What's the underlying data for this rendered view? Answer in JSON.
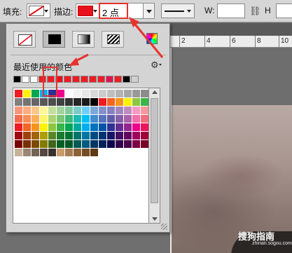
{
  "options_bar": {
    "fill_label": "填充:",
    "stroke_label": "描边:",
    "stroke_size_value": "2 点",
    "width_label": "W:",
    "height_label": "H",
    "stroke_color": "#e8101c"
  },
  "panel": {
    "type_buttons": [
      "none-icon",
      "solid-color-icon",
      "gradient-icon",
      "pattern-icon"
    ],
    "recent_label": "最近使用的颜色",
    "recent_colors": [
      "#000000",
      "#ffffff",
      "#ffffff",
      "#ed1c24",
      "#ed1c24",
      "#e8101c",
      "#ed1c24",
      "#ed1c24",
      "#ed1c24",
      "#ed1c24",
      "#ed1c24",
      "#e0144c",
      "#ed1c24",
      "#000000",
      "#d0d0d0"
    ],
    "swatch_rows": [
      [
        "#ed1c24",
        "#fff200",
        "#00a651",
        "#00aeef",
        "#2e3192",
        "#ec008c",
        "#ffffff",
        "#f2f2f2",
        "#e6e6e6",
        "#d9d9d9",
        "#cccccc",
        "#bfbfbf",
        "#b3b3b3",
        "#a6a6a6",
        "#999999",
        "#8c8c8c"
      ],
      [
        "#808080",
        "#737373",
        "#666666",
        "#595959",
        "#4d4d4d",
        "#404040",
        "#333333",
        "#262626",
        "#1a1a1a",
        "#000000",
        "#ed1c24",
        "#f26522",
        "#f7941d",
        "#fff200",
        "#8dc63f",
        "#39b54a"
      ],
      [
        "#f69679",
        "#f9ad81",
        "#fdc689",
        "#fff799",
        "#c4df9b",
        "#a3d39c",
        "#82ca9c",
        "#7accc8",
        "#6dcff6",
        "#7da7d9",
        "#8393ca",
        "#8781bd",
        "#a187be",
        "#bd8cbf",
        "#f49ac2",
        "#f6989d"
      ],
      [
        "#f26c4f",
        "#f68e56",
        "#fbaf5d",
        "#fff568",
        "#acd373",
        "#7cc576",
        "#3cb878",
        "#1cbbb4",
        "#00bff3",
        "#448ccb",
        "#5674b9",
        "#605ca8",
        "#855fa8",
        "#a864a8",
        "#f06eaa",
        "#f26d7d"
      ],
      [
        "#ed1c24",
        "#f26522",
        "#f7941d",
        "#fff200",
        "#8dc63f",
        "#39b54a",
        "#00a651",
        "#00a99d",
        "#00aeef",
        "#0072bc",
        "#0054a6",
        "#2e3192",
        "#662d91",
        "#92278f",
        "#ec008c",
        "#ed145b"
      ],
      [
        "#9e0b0f",
        "#a0410d",
        "#a36209",
        "#aba000",
        "#598527",
        "#1a7b30",
        "#007236",
        "#00746b",
        "#0076a3",
        "#004b80",
        "#003471",
        "#1b1464",
        "#440e62",
        "#630460",
        "#9e005d",
        "#9e0039"
      ],
      [
        "#790000",
        "#7b2e00",
        "#7d4900",
        "#827b00",
        "#406618",
        "#005e20",
        "#005826",
        "#005952",
        "#005b7f",
        "#003663",
        "#002157",
        "#0d004c",
        "#32004b",
        "#4b0049",
        "#7b0046",
        "#7a0026"
      ],
      [
        "#c7b299",
        "#998675",
        "#736357",
        "#534741",
        "#37302d",
        "#c69c6d",
        "#a67c52",
        "#8c6239",
        "#754c24",
        "#603913"
      ]
    ]
  },
  "ruler": {
    "ticks": [
      "2",
      "4",
      "6",
      "8",
      "10"
    ]
  },
  "watermark": {
    "brand": "搜狗指南",
    "url": "zhinan.sogou.com"
  }
}
